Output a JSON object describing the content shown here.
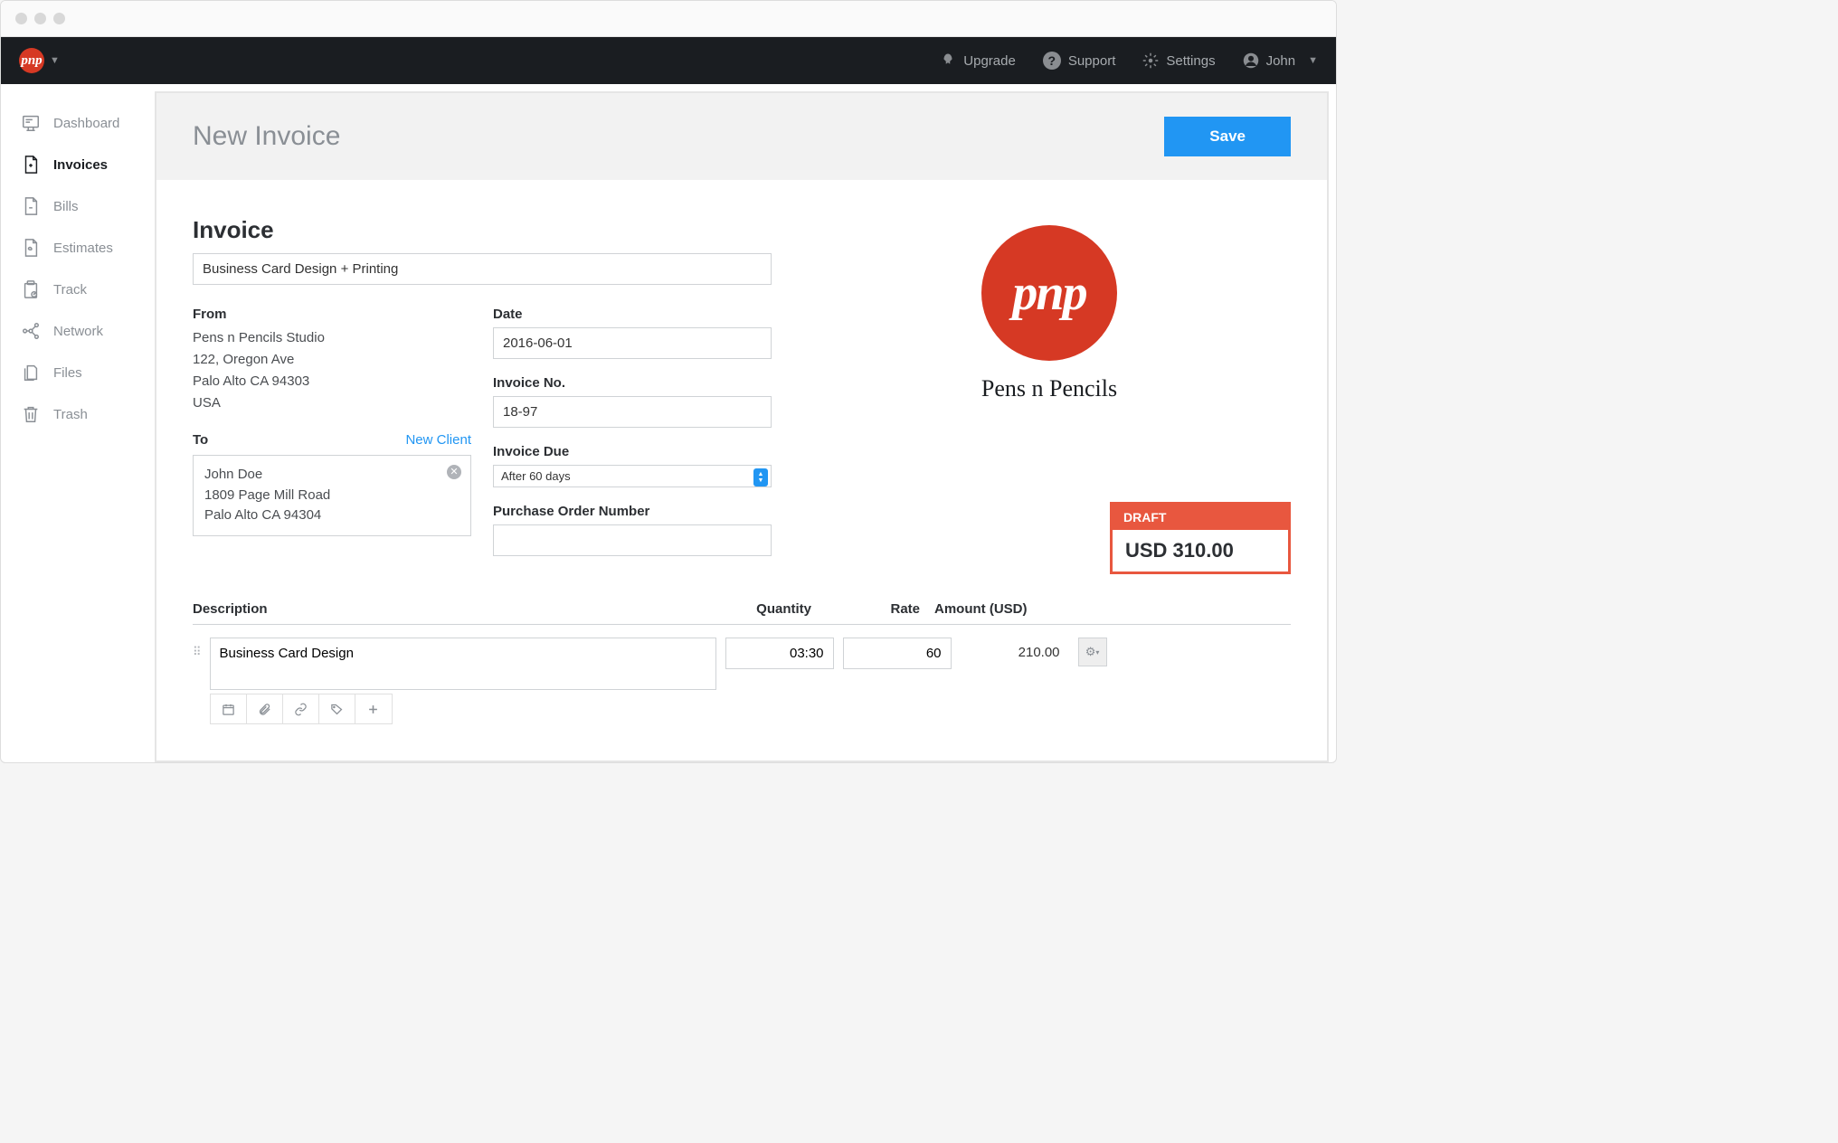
{
  "topnav": {
    "upgrade": "Upgrade",
    "support": "Support",
    "settings": "Settings",
    "user": "John"
  },
  "sidebar": {
    "items": [
      {
        "label": "Dashboard"
      },
      {
        "label": "Invoices"
      },
      {
        "label": "Bills"
      },
      {
        "label": "Estimates"
      },
      {
        "label": "Track"
      },
      {
        "label": "Network"
      },
      {
        "label": "Files"
      },
      {
        "label": "Trash"
      }
    ]
  },
  "header": {
    "title": "New Invoice",
    "save": "Save"
  },
  "invoice": {
    "section_title": "Invoice",
    "title_value": "Business Card Design + Printing",
    "from_label": "From",
    "from_lines": {
      "l1": "Pens n Pencils Studio",
      "l2": "122, Oregon Ave",
      "l3": "Palo Alto CA 94303",
      "l4": "USA"
    },
    "to_label": "To",
    "new_client": "New Client",
    "to_lines": {
      "l1": "John Doe",
      "l2": "1809 Page Mill Road",
      "l3": "Palo Alto CA 94304"
    },
    "date_label": "Date",
    "date_value": "2016-06-01",
    "no_label": "Invoice No.",
    "no_value": "18-97",
    "due_label": "Invoice Due",
    "due_value": "After 60 days",
    "po_label": "Purchase Order Number",
    "po_value": ""
  },
  "company": {
    "logo_text": "pnp",
    "name": "Pens n Pencils"
  },
  "total": {
    "badge": "DRAFT",
    "amount": "USD 310.00"
  },
  "items": {
    "head": {
      "desc": "Description",
      "qty": "Quantity",
      "rate": "Rate",
      "amt": "Amount (USD)"
    },
    "rows": [
      {
        "desc": "Business Card Design",
        "qty": "03:30",
        "rate": "60",
        "amt": "210.00"
      }
    ]
  }
}
